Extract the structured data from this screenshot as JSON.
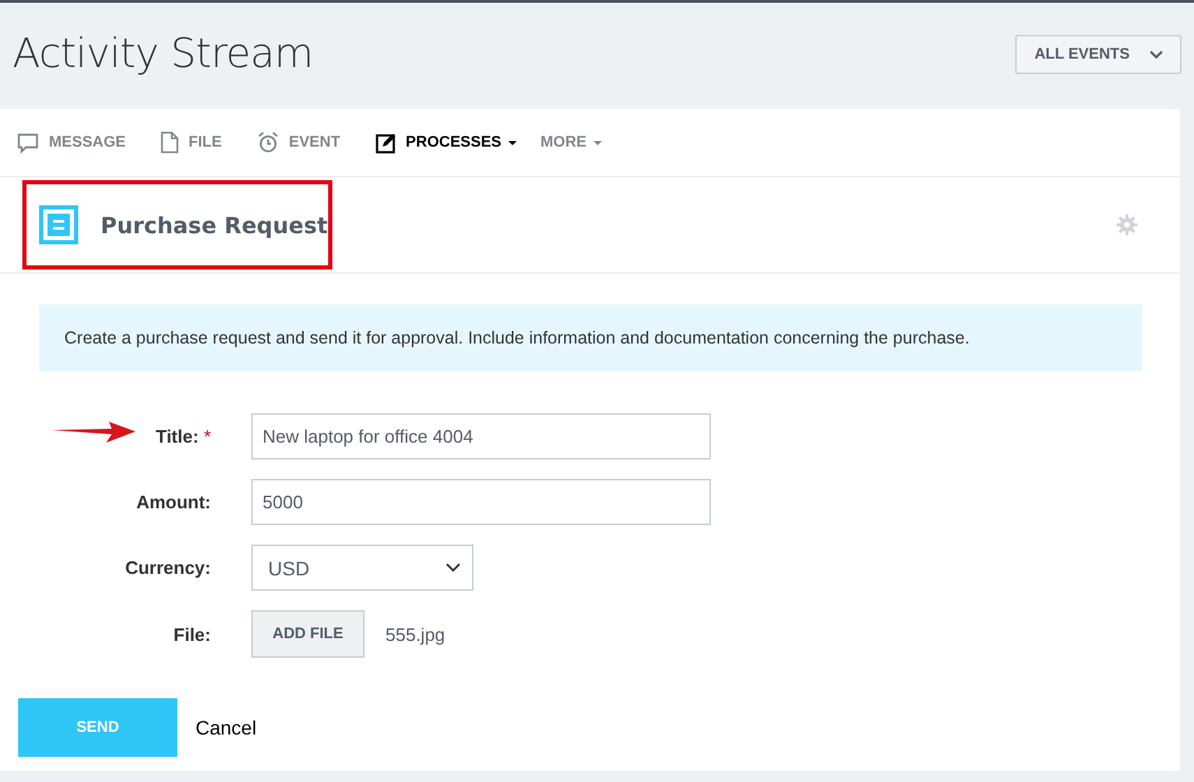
{
  "page": {
    "title": "Activity Stream"
  },
  "filter_button": {
    "label": "ALL EVENTS"
  },
  "tabs": [
    {
      "label": "MESSAGE",
      "selected": false,
      "has_menu": false
    },
    {
      "label": "FILE",
      "selected": false,
      "has_menu": false
    },
    {
      "label": "EVENT",
      "selected": false,
      "has_menu": false
    },
    {
      "label": "PROCESSES",
      "selected": true,
      "has_menu": true
    },
    {
      "label": "MORE",
      "selected": false,
      "has_menu": true
    }
  ],
  "form": {
    "title": "Purchase Request",
    "description": "Create a purchase request and send it for approval. Include information and documentation concerning the purchase.",
    "fields": [
      {
        "kind": "text",
        "label": "Title:",
        "required": true,
        "value": "New laptop for office 4004"
      },
      {
        "kind": "text",
        "label": "Amount:",
        "required": false,
        "value": "5000"
      },
      {
        "kind": "select",
        "label": "Currency:",
        "required": false,
        "value": "USD"
      },
      {
        "kind": "file",
        "label": "File:",
        "required": false,
        "button": "ADD FILE",
        "file_name": "555.jpg"
      }
    ],
    "required_mark": "*",
    "buttons": {
      "send": "SEND",
      "cancel": "Cancel"
    }
  }
}
